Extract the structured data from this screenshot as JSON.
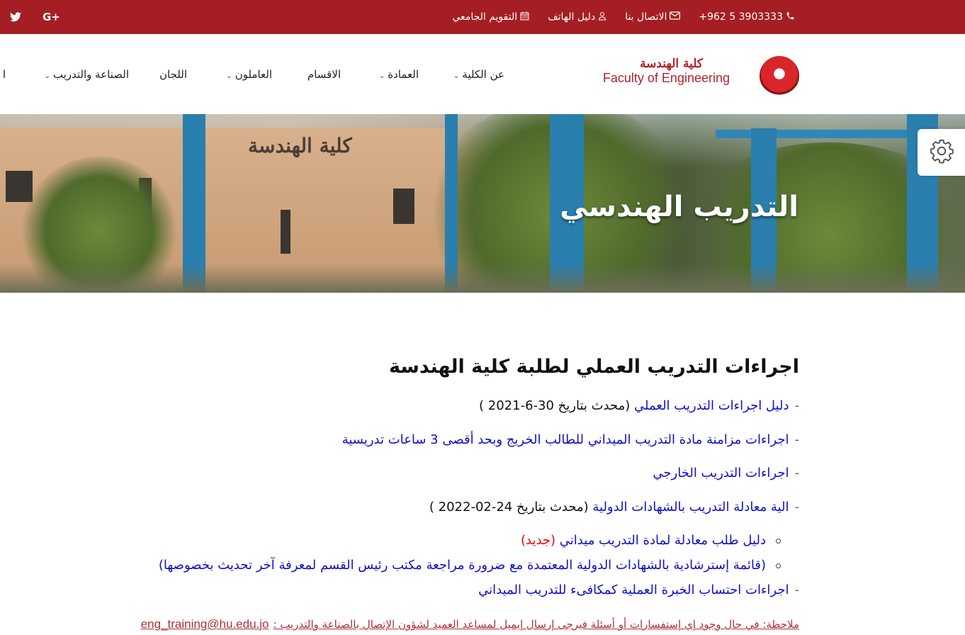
{
  "topbar": {
    "social": [
      "twitter-icon",
      "google-plus-icon"
    ],
    "google_plus_label": "G+",
    "phone": "+962 5 3903333",
    "contact": "الاتصال بنا",
    "directory": "دليل الهاتف",
    "calendar": "التقويم الجامعي",
    "bg_color": "#a51e23"
  },
  "logo": {
    "ar": "كلية الهندسة",
    "en": "Faculty of Engineering"
  },
  "nav": {
    "items": [
      {
        "label": "عن الكلية",
        "has_dropdown": true
      },
      {
        "label": "العمادة",
        "has_dropdown": true
      },
      {
        "label": "الاقسام",
        "has_dropdown": false
      },
      {
        "label": "العاملون",
        "has_dropdown": true
      },
      {
        "label": "اللجان",
        "has_dropdown": false
      },
      {
        "label": "الصناعة والتدريب",
        "has_dropdown": true
      },
      {
        "label": "ا",
        "has_dropdown": false
      }
    ]
  },
  "banner": {
    "title": "التدريب الهندسي",
    "sign_text": "كلية الهندسة"
  },
  "content": {
    "heading": "اجراءات التدريب العملي لطلبة كلية الهندسة",
    "items": [
      {
        "link": "دليل  اجراءات التدريب العملي",
        "suffix": " (محدث بتاريخ 30-6-2021 )"
      },
      {
        "link": "اجراءات مزامنة مادة التدريب الميداني للطالب الخريج وبحد أقصى 3 ساعات تدريسية",
        "suffix": ""
      },
      {
        "link": "اجراءات التدريب الخارجي",
        "suffix": ""
      },
      {
        "link": "الية معادلة التدريب بالشهادات الدولية",
        "suffix": " (محدث بتاريخ 24-02-2022 )"
      }
    ],
    "subitems": [
      {
        "link": "دليل طلب معادلة لمادة التدريب ميداني",
        "badge": "(جديد)"
      },
      {
        "link": "(قائمة إسترشادية بالشهادات الدولية المعتمدة مع ضرورة مراجعة مكتب رئيس القسم لمعرفة آخر تحديث بخصوصها)",
        "badge": ""
      }
    ],
    "last_item": "اجراءات احتساب الخبرة العملية كمكافىء للتدريب الميداني",
    "note": "ملاحظة: في حال وجود إي إستفسارات أو أسئلة فيرجى إرسال إيميل لمساعد العميد لشؤون الإتصال بالصناعة والتدريب :",
    "email": "eng_training@hu.edu.jo",
    "link_color": "#1010c8",
    "new_color": "#e00000"
  }
}
